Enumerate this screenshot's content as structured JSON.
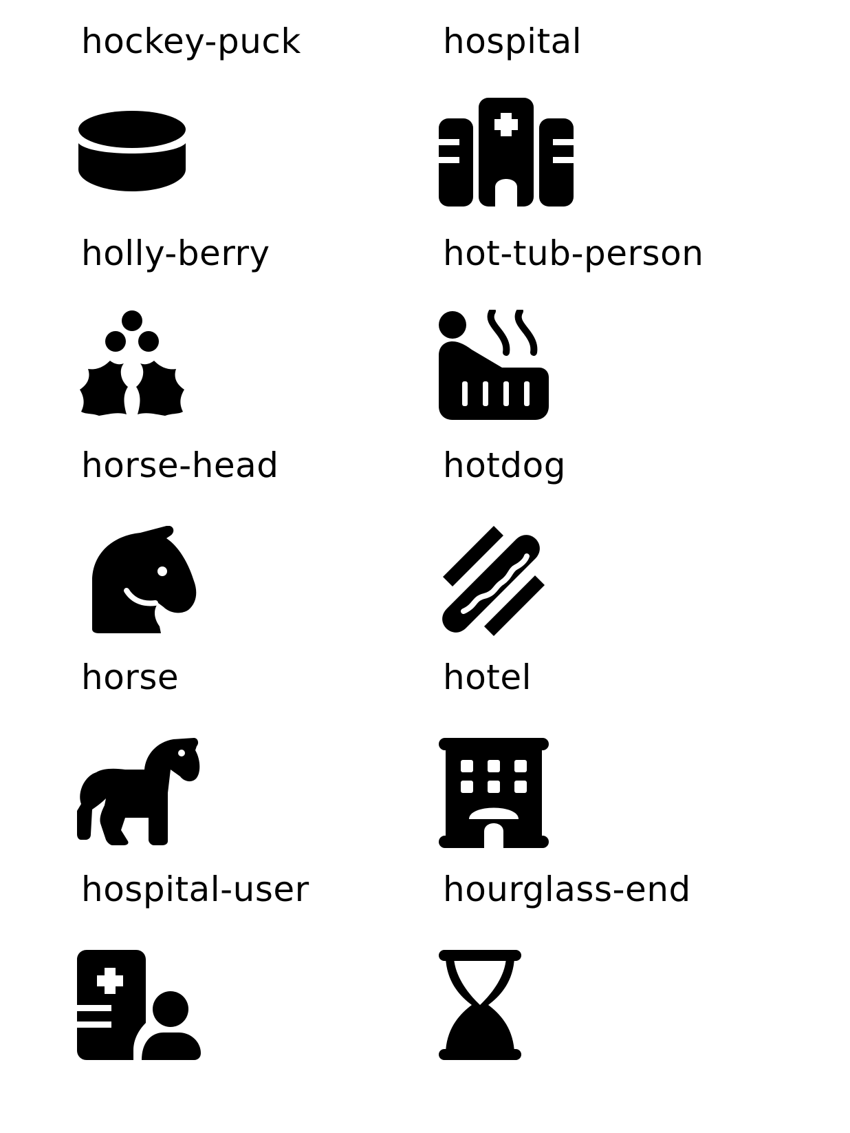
{
  "icons": [
    {
      "label": "hockey-puck",
      "icon": "hockey-puck-icon"
    },
    {
      "label": "hospital",
      "icon": "hospital-icon"
    },
    {
      "label": "holly-berry",
      "icon": "holly-berry-icon"
    },
    {
      "label": "hot-tub-person",
      "icon": "hot-tub-person-icon"
    },
    {
      "label": "horse-head",
      "icon": "horse-head-icon"
    },
    {
      "label": "hotdog",
      "icon": "hotdog-icon"
    },
    {
      "label": "horse",
      "icon": "horse-icon"
    },
    {
      "label": "hotel",
      "icon": "hotel-icon"
    },
    {
      "label": "hospital-user",
      "icon": "hospital-user-icon"
    },
    {
      "label": "hourglass-end",
      "icon": "hourglass-end-icon"
    }
  ],
  "colors": {
    "foreground": "#000000",
    "background": "#ffffff"
  }
}
